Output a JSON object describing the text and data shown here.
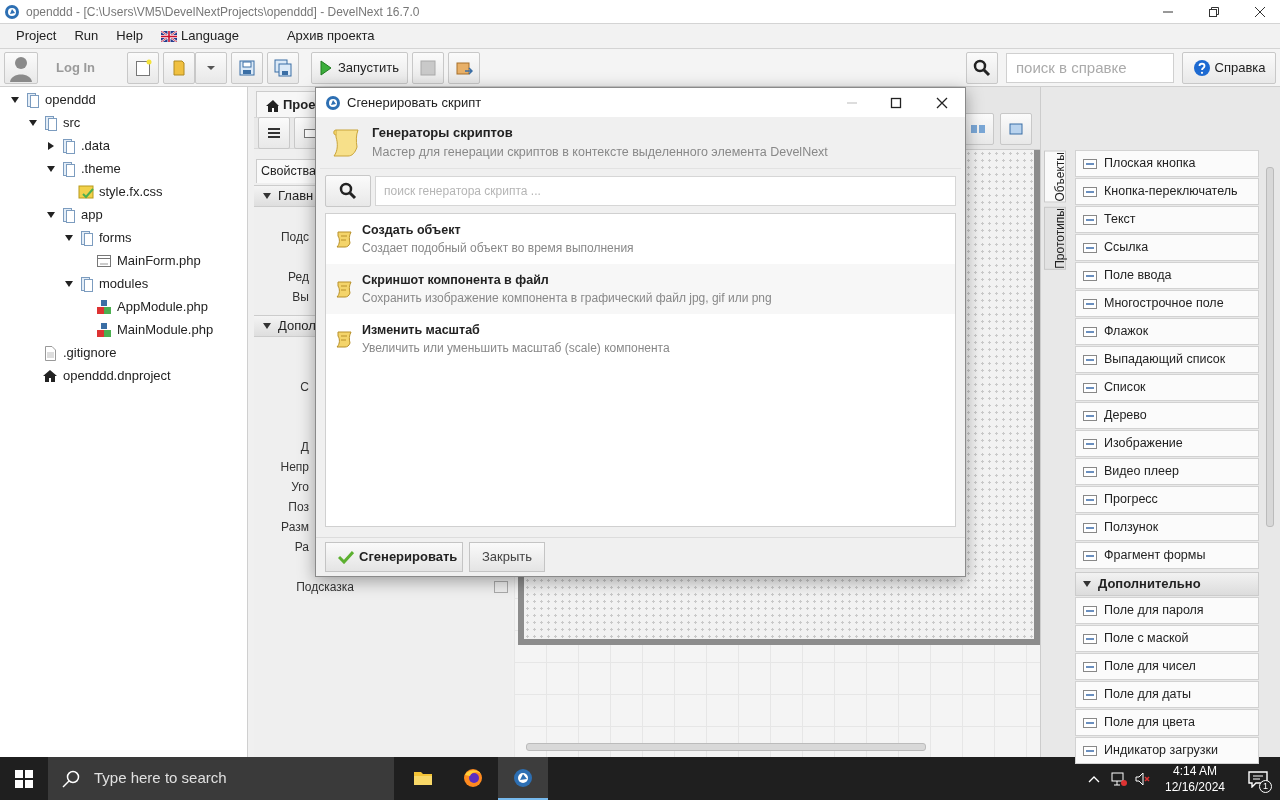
{
  "window": {
    "title": "openddd - [C:\\Users\\VM5\\DevelNextProjects\\openddd] - DevelNext 16.7.0"
  },
  "menu": [
    {
      "label": "Project",
      "kind": "plain"
    },
    {
      "label": "Run",
      "kind": "plain"
    },
    {
      "label": "Help",
      "kind": "plain"
    },
    {
      "label": "Language",
      "kind": "language"
    },
    {
      "label": "Архив проекта",
      "kind": "plain"
    }
  ],
  "toolbar": {
    "login": "Log In",
    "run": "Запустить",
    "help_search": {
      "placeholder": "поиск в справке"
    },
    "help": "Справка"
  },
  "tree": [
    {
      "label": "openddd",
      "kind": "folder",
      "expanded": true,
      "children": [
        {
          "label": "src",
          "kind": "folder",
          "expanded": true,
          "children": [
            {
              "label": ".data",
              "kind": "folder",
              "expanded": false
            },
            {
              "label": ".theme",
              "kind": "folder",
              "expanded": true,
              "children": [
                {
                  "label": "style.fx.css",
                  "kind": "stylesheet"
                }
              ]
            },
            {
              "label": "app",
              "kind": "folder",
              "expanded": true,
              "children": [
                {
                  "label": "forms",
                  "kind": "folder",
                  "expanded": true,
                  "children": [
                    {
                      "label": "MainForm.php",
                      "kind": "form"
                    }
                  ]
                },
                {
                  "label": "modules",
                  "kind": "folder",
                  "expanded": true,
                  "children": [
                    {
                      "label": "AppModule.php",
                      "kind": "module"
                    },
                    {
                      "label": "MainModule.php",
                      "kind": "module"
                    }
                  ]
                }
              ]
            }
          ]
        },
        {
          "label": ".gitignore",
          "kind": "file"
        },
        {
          "label": "openddd.dnproject",
          "kind": "project"
        }
      ]
    }
  ],
  "editor": {
    "tab": "Прое",
    "properties_tab": "Свойства",
    "groups": [
      {
        "label": "Главн",
        "expanded": true,
        "rows": [
          {
            "kind": "blank"
          },
          {
            "kind": "field",
            "label": "Подс"
          },
          {
            "kind": "blank"
          },
          {
            "kind": "field",
            "label": "Ред"
          },
          {
            "kind": "field",
            "label": "Вы"
          }
        ]
      },
      {
        "label": "Допол",
        "expanded": true,
        "rows": [
          {
            "kind": "blank"
          },
          {
            "kind": "blank"
          },
          {
            "kind": "field",
            "label": "С"
          },
          {
            "kind": "blank"
          },
          {
            "kind": "blank"
          },
          {
            "kind": "field",
            "label": "Д"
          },
          {
            "kind": "field",
            "label": "Непр"
          },
          {
            "kind": "field",
            "label": "Уго"
          },
          {
            "kind": "field",
            "label": "Поз"
          },
          {
            "kind": "field",
            "label": "Разм"
          },
          {
            "kind": "field",
            "label": "Ра"
          },
          {
            "kind": "blank"
          },
          {
            "kind": "field_with_button",
            "label": "Подсказка"
          }
        ]
      }
    ]
  },
  "palette": {
    "tabs": [
      {
        "label": "Объекты",
        "selected": true
      },
      {
        "label": "Прототипы",
        "selected": false
      }
    ],
    "sections": [
      {
        "items": [
          "Плоская кнопка",
          "Кнопка-переключатель",
          "Текст",
          "Ссылка",
          "Поле ввода",
          "Многострочное поле",
          "Флажок",
          "Выпадающий список",
          "Список",
          "Дерево",
          "Изображение",
          "Видео плеер",
          "Прогресс",
          "Ползунок",
          "Фрагмент формы"
        ]
      },
      {
        "label": "Дополнительно",
        "expanded": true,
        "items": [
          "Поле для пароля",
          "Поле с маской",
          "Поле для чисел",
          "Поле для даты",
          "Поле для цвета",
          "Индикатор загрузки"
        ]
      }
    ]
  },
  "dialog": {
    "title": "Сгенерировать скрипт",
    "heading": "Генераторы скриптов",
    "subtitle": "Мастер для генерации скриптов в контексте выделенного элемента DevelNext",
    "search": {
      "placeholder": "поиск генератора скрипта ..."
    },
    "items": [
      {
        "title": "Создать объект",
        "description": "Создает подобный объект во время выполнения"
      },
      {
        "title": "Скриншот компонента в файл",
        "description": "Сохранить изображение компонента в графический файл jpg, gif или png"
      },
      {
        "title": "Изменить масштаб",
        "description": "Увеличить или уменьшить масштаб (scale) компонента"
      }
    ],
    "buttons": [
      {
        "label": "Сгенерировать",
        "kind": "primary"
      },
      {
        "label": "Закрыть",
        "kind": "secondary"
      }
    ]
  },
  "taskbar": {
    "search": {
      "placeholder": "Type here to search"
    },
    "apps": [
      {
        "kind": "explorer",
        "selected": false
      },
      {
        "kind": "firefox",
        "selected": false
      },
      {
        "kind": "develnext",
        "selected": true
      }
    ],
    "time": "4:14 AM",
    "date": "12/16/2024",
    "notifications": "1"
  }
}
